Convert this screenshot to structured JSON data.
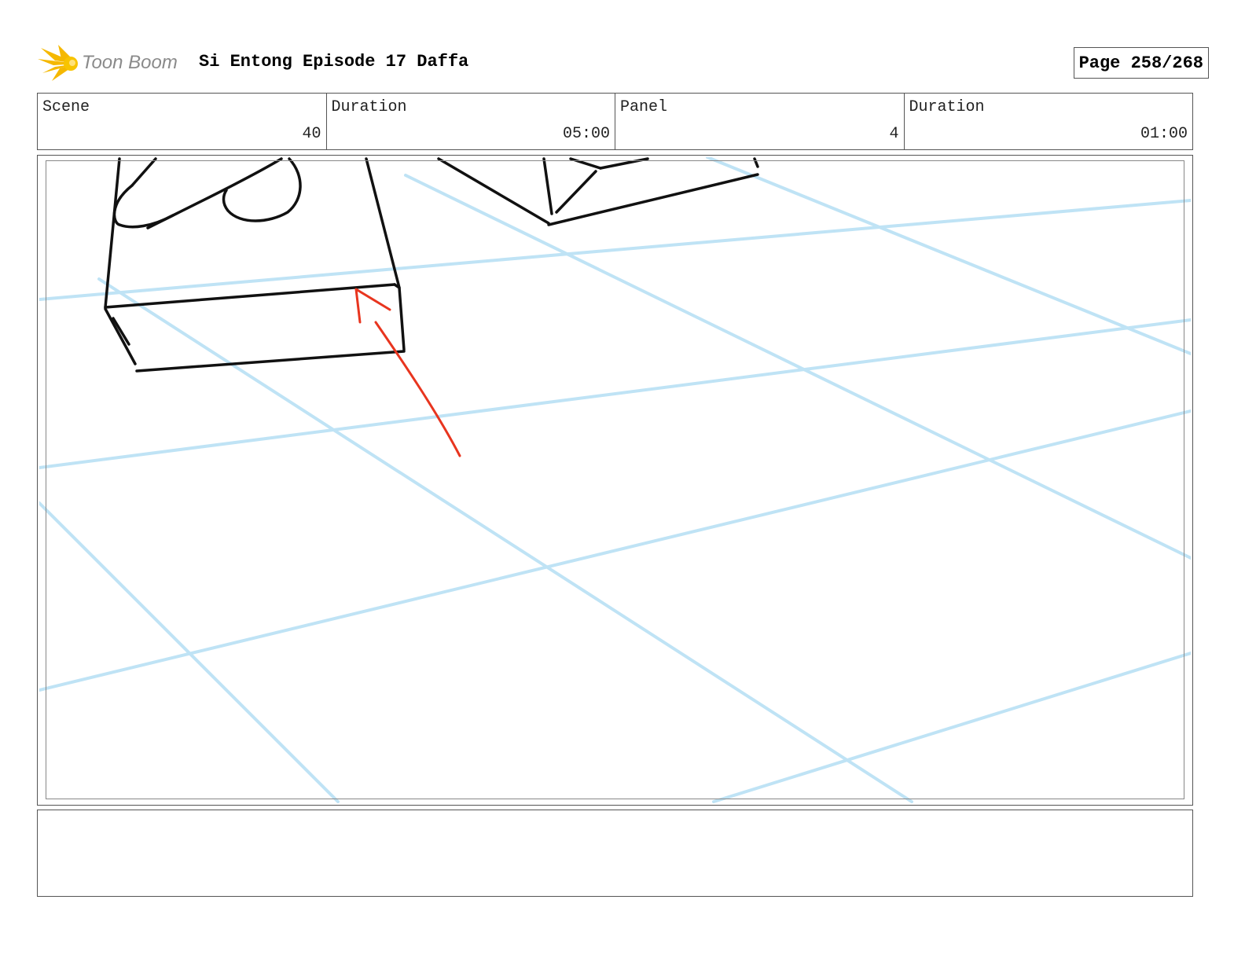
{
  "header": {
    "logo_text": "Toon Boom",
    "title": "Si Entong Episode 17 Daffa",
    "page_label": "Page 258/268"
  },
  "info": {
    "scene_label": "Scene",
    "scene_value": "40",
    "scene_duration_label": "Duration",
    "scene_duration_value": "05:00",
    "panel_label": "Panel",
    "panel_value": "4",
    "panel_duration_label": "Duration",
    "panel_duration_value": "01:00"
  },
  "colors": {
    "guide_lines": "#bfe3f5",
    "sketch_lines": "#111111",
    "annotation_arrow": "#e8351f",
    "logo_accent": "#f5b800"
  },
  "caption": {
    "text": ""
  }
}
